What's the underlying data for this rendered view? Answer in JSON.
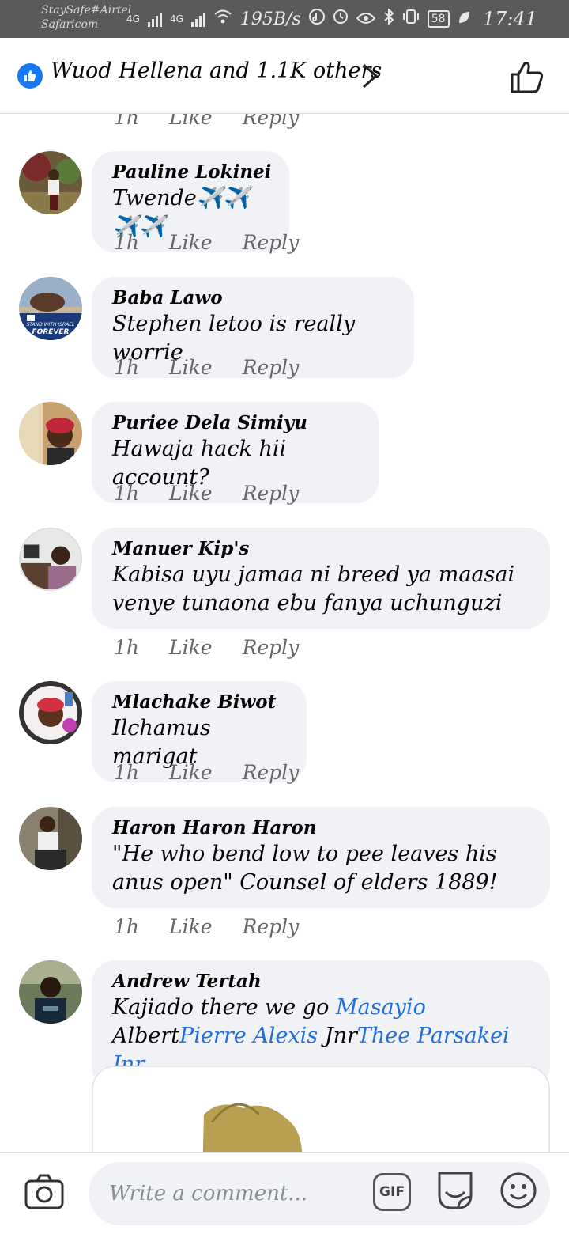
{
  "status_bar": {
    "carrier_1": "StaySafe#Airtel",
    "carrier_2": "Safaricom",
    "net_1": "4G",
    "net_2": "4G",
    "speed": "195B/s",
    "battery": "58",
    "time": "17:41"
  },
  "header": {
    "reactions": "Wuod Hellena and 1.1K others"
  },
  "actions": {
    "time": "1h",
    "like": "Like",
    "reply": "Reply"
  },
  "comments": [
    {
      "author": "Pauline Lokinei",
      "text": "Twende✈️✈️✈️✈️",
      "time": "1h"
    },
    {
      "author": "Baba Lawo",
      "text": "Stephen letoo is really worrie",
      "time": "1h"
    },
    {
      "author": "Puriee Dela Simiyu",
      "text": "Hawaja hack hii account?",
      "time": "1h"
    },
    {
      "author": "Manuer Kip's",
      "text": "Kabisa uyu jamaa ni breed ya maasai venye tunaona ebu fanya uchunguzi",
      "time": "1h"
    },
    {
      "author": "Mlachake Biwot",
      "text": "Ilchamus marigat",
      "time": "1h"
    },
    {
      "author": "Haron Haron Haron",
      "text": "\"He who bend low to pee leaves his anus open\" Counsel of elders 1889!",
      "time": "1h"
    },
    {
      "author": "Andrew Tertah",
      "text_plain_1": "Kajiado there we go ",
      "mention_1": "Masayio",
      "text_plain_2": " Albert",
      "mention_2": "Pierre Alexis",
      "text_plain_3": " Jnr",
      "mention_3": "Thee Parsakei Jnr"
    }
  ],
  "composer": {
    "placeholder": "Write a comment...",
    "gif_label": "GIF"
  },
  "colors": {
    "accent": "#1877f2",
    "mention": "#216fdb",
    "bubble": "#f0f2f5",
    "meta": "#65676b"
  }
}
